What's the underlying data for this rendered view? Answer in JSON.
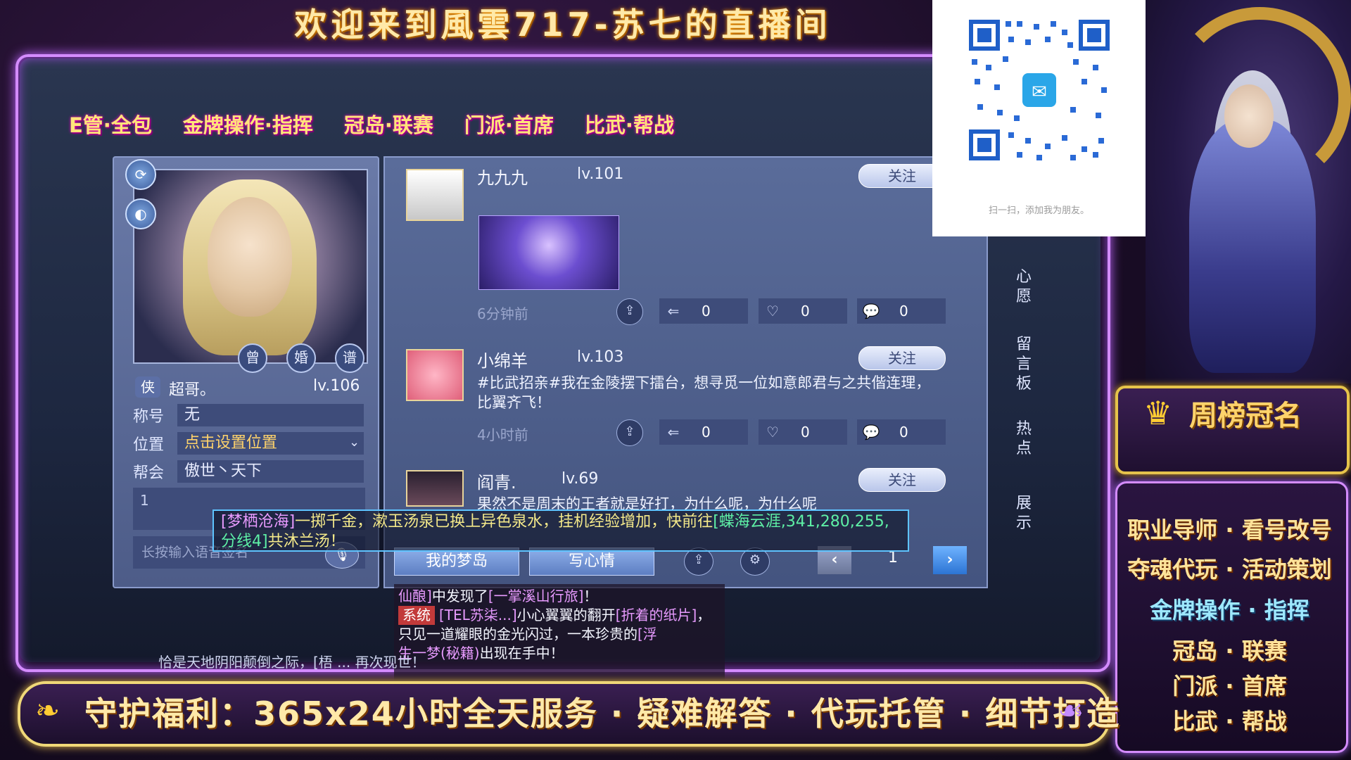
{
  "title": "欢迎来到風雲717-苏七的直播间",
  "marquee": [
    "E管·全包",
    "金牌操作·指挥",
    "冠岛·联赛",
    "门派·首席",
    "比武·帮战"
  ],
  "profile": {
    "badges": [
      "曾",
      "婚",
      "谱"
    ],
    "rank_badge": "侠",
    "name": "超哥。",
    "level": "lv.106",
    "title_label": "称号",
    "title_value": "无",
    "location_label": "位置",
    "location_value": "点击设置位置",
    "guild_label": "帮会",
    "guild_value": "傲世丶天下",
    "signature": "1",
    "input_placeholder": "长按输入语音签名"
  },
  "posts": [
    {
      "name": "九九九",
      "level": "lv.101",
      "follow": "关注",
      "time": "6分钟前",
      "forward": "0",
      "likes": "0",
      "comments": "0"
    },
    {
      "name": "小绵羊",
      "level": "lv.103",
      "follow": "关注",
      "text": "#比武招亲#我在金陵摆下擂台，想寻觅一位如意郎君与之共偕连理，比翼齐飞！",
      "time": "4小时前",
      "forward": "0",
      "likes": "0",
      "comments": "0"
    },
    {
      "name": "阎青.",
      "level": "lv.69",
      "follow": "关注",
      "text": "果然不是周末的王者就是好打，为什么呢，为什么呢"
    }
  ],
  "tabs": {
    "my_island": "我的梦岛",
    "write_mood": "写心情",
    "page": "1"
  },
  "side_tabs": [
    "心愿",
    "留言板",
    "热点",
    "展示"
  ],
  "chat": {
    "tag_open": "[梦栖沧海]",
    "text1": "一掷千金，漱玉汤泉已换上异色泉水，挂机经验增加，快前往",
    "link": "[蝶海云涯,341,280,255,分线4]",
    "text2": "共沐兰汤！"
  },
  "system": {
    "line0_a": "仙酿]",
    "line0_b": "中发现了",
    "line0_c": "[一掌溪山行旅]",
    "line0_d": "！",
    "tag": "系统",
    "l1_a": "[TEL苏柒...]",
    "l1_b": "小心翼翼的翻开",
    "l1_c": "[折着的纸片]",
    "l1_d": "，",
    "l2_a": "只见一道耀眼的金光闪过，一本珍贵的",
    "l2_b": "[浮",
    "l3_a": "生一梦(秘籍)",
    "l3_b": "出现在手中！"
  },
  "ticker": "恰是天地阴阳颠倒之际，[梧 ... 再次现世！",
  "qr_caption": "扫一扫，添加我为朋友。",
  "weekly_title": "周榜冠名",
  "services": [
    "职业导师 · 看号改号",
    "夺魂代玩 · 活动策划",
    "金牌操作 · 指挥",
    "冠岛 · 联赛",
    "门派 · 首席",
    "比武 · 帮战"
  ],
  "bottom_banner": "守护福利：365x24小时全天服务 · 疑难解答 · 代玩托管 · 细节打造",
  "icons": {
    "refresh": "refresh-icon",
    "mask": "mask-icon",
    "share": "share-icon",
    "like": "heart-icon",
    "comment": "comment-icon",
    "forward": "forward-icon",
    "mic": "mic-icon",
    "settings": "gear-icon",
    "crown": "crown-icon",
    "wing": "wing-icon",
    "wechat": "wechat-icon"
  }
}
